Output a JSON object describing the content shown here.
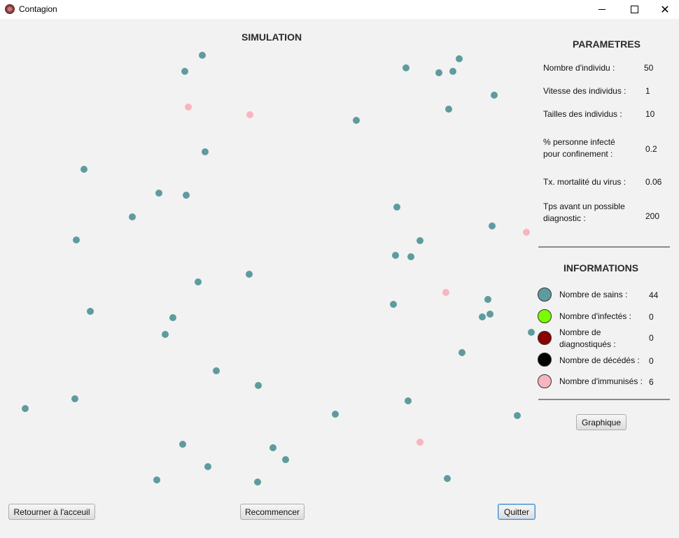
{
  "window": {
    "title": "Contagion",
    "controls": {
      "minimize": "minimize-icon",
      "maximize": "maximize-icon",
      "close": "✕"
    }
  },
  "simulation": {
    "title": "SIMULATION",
    "colors": {
      "sain": "#5e9b9e",
      "immunise": "#f8b4bf"
    },
    "individuals": [
      {
        "status": "sain"
      },
      {
        "status": "sain"
      },
      {
        "status": "immunise"
      },
      {
        "status": "immunise"
      },
      {
        "status": "sain"
      },
      {
        "status": "sain"
      },
      {
        "status": "sain"
      },
      {
        "status": "sain"
      },
      {
        "status": "sain"
      },
      {
        "status": "sain"
      },
      {
        "status": "sain"
      },
      {
        "status": "sain"
      },
      {
        "status": "sain"
      },
      {
        "status": "sain"
      },
      {
        "status": "sain"
      },
      {
        "status": "sain"
      },
      {
        "status": "sain"
      },
      {
        "status": "sain"
      },
      {
        "status": "sain"
      },
      {
        "status": "sain"
      },
      {
        "status": "sain"
      },
      {
        "status": "sain"
      },
      {
        "status": "sain"
      },
      {
        "status": "sain"
      },
      {
        "status": "immunise"
      },
      {
        "status": "sain"
      },
      {
        "status": "sain"
      },
      {
        "status": "immunise"
      },
      {
        "status": "sain"
      },
      {
        "status": "sain"
      },
      {
        "status": "sain"
      },
      {
        "status": "sain"
      },
      {
        "status": "sain"
      },
      {
        "status": "sain"
      },
      {
        "status": "sain"
      },
      {
        "status": "sain"
      },
      {
        "status": "sain"
      },
      {
        "status": "sain"
      },
      {
        "status": "sain"
      },
      {
        "status": "sain"
      },
      {
        "status": "sain"
      },
      {
        "status": "sain"
      },
      {
        "status": "sain"
      },
      {
        "status": "immunise"
      },
      {
        "status": "sain"
      },
      {
        "status": "sain"
      },
      {
        "status": "sain"
      },
      {
        "status": "sain"
      },
      {
        "status": "sain"
      },
      {
        "status": "sain"
      }
    ]
  },
  "parametres": {
    "title": "PARAMETRES",
    "nombre_individu": {
      "label": "Nombre d'individu :",
      "value": "50"
    },
    "vitesse": {
      "label": "Vitesse des individus :",
      "value": "1"
    },
    "tailles": {
      "label": "Tailles des individus :",
      "value": "10"
    },
    "confinement": {
      "label_line1": "%  personne infecté",
      "label_line2": "pour confinement :",
      "value": "0.2"
    },
    "mortalite": {
      "label": "Tx. mortalité du virus :",
      "value": "0.06"
    },
    "diagnostic": {
      "label_line1": "Tps avant un possible",
      "label_line2": "diagnostic :",
      "value": "200"
    }
  },
  "informations": {
    "title": "INFORMATIONS",
    "sains": {
      "label": "Nombre de sains :",
      "value": "44",
      "color": "#5e9b9e"
    },
    "infectes": {
      "label": "Nombre d'infectés :",
      "value": "0",
      "color": "#7cfc00"
    },
    "diagnostiques": {
      "label_line1": "Nombre de",
      "label_line2": "diagnostiqués :",
      "value": "0",
      "color": "#8b0000"
    },
    "decedes": {
      "label": "Nombre de décédés :",
      "value": "0",
      "color": "#000000"
    },
    "immunises": {
      "label": "Nombre d'immunisés :",
      "value": "6",
      "color": "#f8b4bf"
    }
  },
  "buttons": {
    "graphique": "Graphique",
    "retour": "Retourner à l'acceuil",
    "recommencer": "Recommencer",
    "quitter": "Quitter"
  }
}
